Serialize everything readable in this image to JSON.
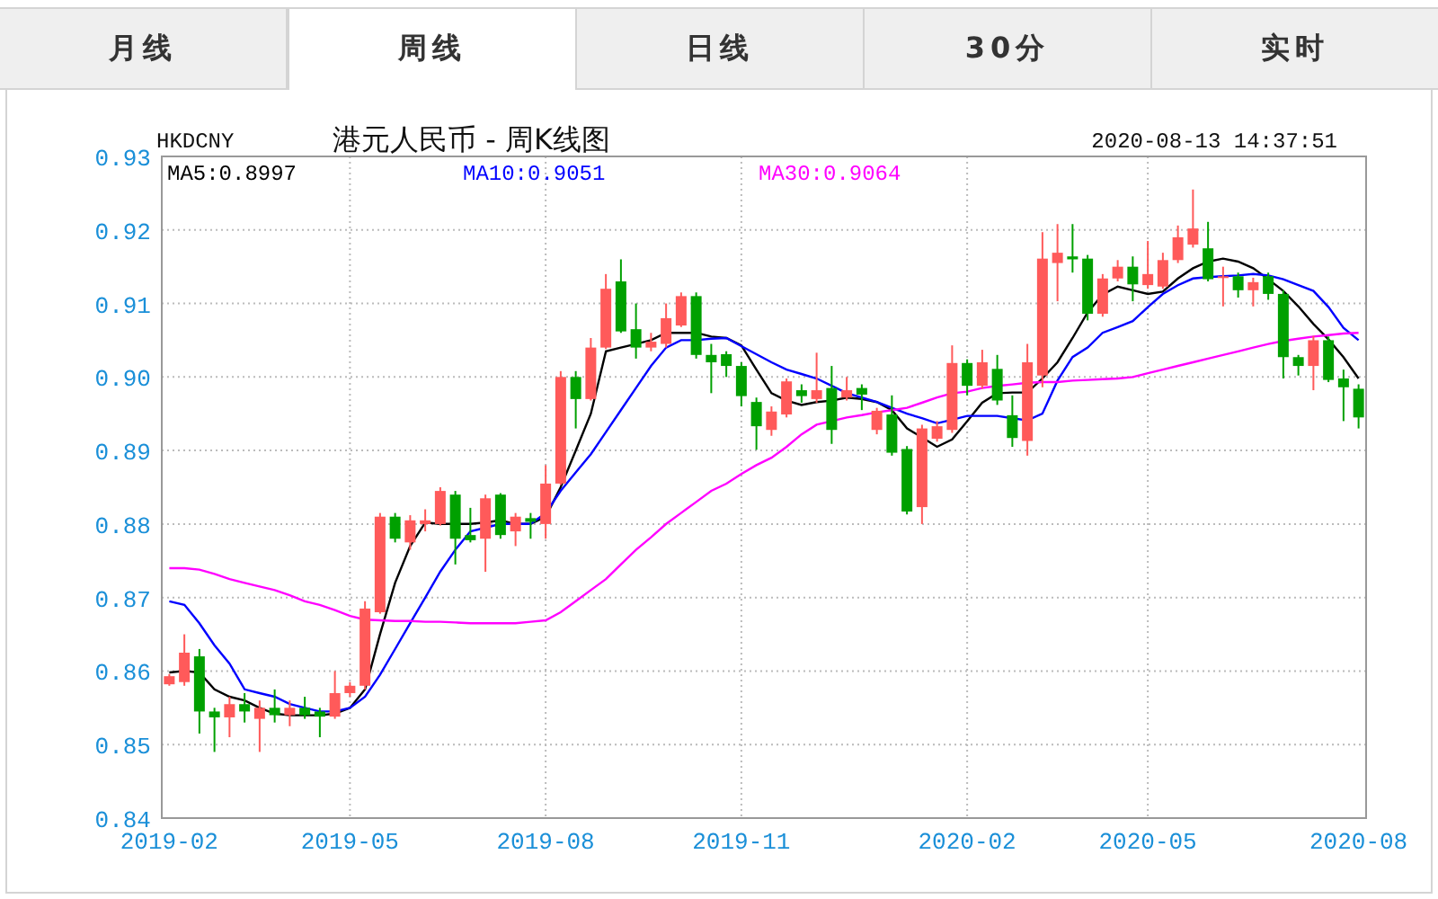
{
  "tabs": [
    {
      "label": "月线",
      "selected": false
    },
    {
      "label": "周线",
      "selected": true
    },
    {
      "label": "日线",
      "selected": false
    },
    {
      "label": "30分",
      "selected": false
    },
    {
      "label": "实时",
      "selected": false
    }
  ],
  "chart": {
    "symbol": "HKDCNY",
    "title": "港元人民币 - 周K线图",
    "timestamp": "2020-08-13 14:37:51",
    "chart_data": {
      "type": "candlestick",
      "grid": true,
      "categories": [
        "2019-02",
        null,
        null,
        null,
        null,
        null,
        null,
        null,
        null,
        null,
        null,
        null,
        "2019-05",
        null,
        null,
        null,
        null,
        null,
        null,
        null,
        null,
        null,
        null,
        null,
        null,
        "2019-08",
        null,
        null,
        null,
        null,
        null,
        null,
        null,
        null,
        null,
        null,
        null,
        null,
        "2019-11",
        null,
        null,
        null,
        null,
        null,
        null,
        null,
        null,
        null,
        null,
        null,
        null,
        null,
        null,
        "2020-02",
        null,
        null,
        null,
        null,
        null,
        null,
        null,
        null,
        null,
        null,
        null,
        "2020-05",
        null,
        null,
        null,
        null,
        null,
        null,
        null,
        null,
        null,
        null,
        null,
        null,
        null,
        "2020-08"
      ],
      "ylim": [
        0.84,
        0.93
      ],
      "yticks": [
        {
          "value": 0.84,
          "label": "0.84"
        },
        {
          "value": 0.85,
          "label": "0.85"
        },
        {
          "value": 0.86,
          "label": "0.86"
        },
        {
          "value": 0.87,
          "label": "0.87"
        },
        {
          "value": 0.88,
          "label": "0.88"
        },
        {
          "value": 0.89,
          "label": "0.89"
        },
        {
          "value": 0.9,
          "label": "0.90"
        },
        {
          "value": 0.91,
          "label": "0.91"
        },
        {
          "value": 0.92,
          "label": "0.92"
        },
        {
          "value": 0.93,
          "label": "0.93"
        }
      ],
      "series": [
        {
          "name": "MA5:0.8997",
          "type": "line",
          "color": "#000000",
          "values": [
            0.8598,
            0.86,
            0.8598,
            0.8575,
            0.8565,
            0.856,
            0.855,
            0.8542,
            0.854,
            0.854,
            0.854,
            0.8542,
            0.855,
            0.8575,
            0.865,
            0.872,
            0.877,
            0.8802,
            0.88,
            0.88,
            0.88,
            0.8802,
            0.8805,
            0.88,
            0.88,
            0.881,
            0.885,
            0.89,
            0.895,
            0.9035,
            0.904,
            0.9045,
            0.905,
            0.906,
            0.906,
            0.906,
            0.9055,
            0.9053,
            0.9043,
            0.901,
            0.8978,
            0.8968,
            0.8962,
            0.8966,
            0.8968,
            0.8972,
            0.897,
            0.8966,
            0.8955,
            0.893,
            0.8918,
            0.8905,
            0.8915,
            0.894,
            0.8965,
            0.8978,
            0.8979,
            0.8979,
            0.8998,
            0.902,
            0.9053,
            0.9088,
            0.9112,
            0.9123,
            0.9118,
            0.9113,
            0.9116,
            0.9134,
            0.9148,
            0.9157,
            0.9161,
            0.9157,
            0.9148,
            0.9133,
            0.9117,
            0.9096,
            0.9072,
            0.9051,
            0.9027,
            0.8998
          ]
        },
        {
          "name": "MA10:0.9051",
          "type": "line",
          "color": "#0000ff",
          "values": [
            0.8695,
            0.869,
            0.8665,
            0.8635,
            0.861,
            0.8575,
            0.857,
            0.8565,
            0.8555,
            0.855,
            0.8545,
            0.8545,
            0.855,
            0.8565,
            0.8595,
            0.863,
            0.8665,
            0.87,
            0.8735,
            0.8765,
            0.879,
            0.8795,
            0.88,
            0.88,
            0.88,
            0.8815,
            0.8845,
            0.887,
            0.8895,
            0.8925,
            0.8955,
            0.8985,
            0.9015,
            0.904,
            0.905,
            0.905,
            0.9052,
            0.9053,
            0.9042,
            0.9031,
            0.902,
            0.901,
            0.9004,
            0.8998,
            0.8988,
            0.8978,
            0.8972,
            0.8966,
            0.8958,
            0.895,
            0.8944,
            0.8937,
            0.8942,
            0.8947,
            0.8947,
            0.8947,
            0.8944,
            0.8941,
            0.895,
            0.8995,
            0.9027,
            0.904,
            0.906,
            0.9068,
            0.9076,
            0.9095,
            0.9113,
            0.9125,
            0.9134,
            0.9136,
            0.9137,
            0.9138,
            0.914,
            0.9138,
            0.9133,
            0.9125,
            0.9117,
            0.9095,
            0.9067,
            0.905
          ]
        },
        {
          "name": "MA30:0.9064",
          "type": "line",
          "color": "#ff00ff",
          "values": [
            0.874,
            0.874,
            0.8738,
            0.8732,
            0.8725,
            0.872,
            0.8715,
            0.871,
            0.8703,
            0.8695,
            0.869,
            0.8683,
            0.8675,
            0.867,
            0.8669,
            0.8668,
            0.8668,
            0.8667,
            0.8667,
            0.8666,
            0.8665,
            0.8665,
            0.8665,
            0.8665,
            0.8667,
            0.8669,
            0.868,
            0.8695,
            0.871,
            0.8725,
            0.8745,
            0.8765,
            0.8782,
            0.88,
            0.8815,
            0.883,
            0.8845,
            0.8855,
            0.8868,
            0.888,
            0.889,
            0.8905,
            0.8922,
            0.8935,
            0.894,
            0.8945,
            0.8948,
            0.8952,
            0.8955,
            0.8958,
            0.8965,
            0.8972,
            0.8978,
            0.898,
            0.8985,
            0.8988,
            0.899,
            0.8992,
            0.8993,
            0.8993,
            0.8995,
            0.8996,
            0.8997,
            0.8998,
            0.9,
            0.9005,
            0.901,
            0.9015,
            0.902,
            0.9025,
            0.903,
            0.9035,
            0.904,
            0.9045,
            0.9049,
            0.9052,
            0.9055,
            0.9057,
            0.9059,
            0.906
          ]
        }
      ],
      "ohlc": [
        [
          0.8582,
          0.8596,
          0.858,
          0.8593
        ],
        [
          0.8585,
          0.865,
          0.858,
          0.8625
        ],
        [
          0.862,
          0.863,
          0.8515,
          0.8545
        ],
        [
          0.8545,
          0.855,
          0.849,
          0.8537
        ],
        [
          0.8537,
          0.8565,
          0.851,
          0.8555
        ],
        [
          0.8555,
          0.857,
          0.853,
          0.8545
        ],
        [
          0.8535,
          0.856,
          0.849,
          0.855
        ],
        [
          0.855,
          0.8575,
          0.853,
          0.854
        ],
        [
          0.854,
          0.856,
          0.8525,
          0.855
        ],
        [
          0.855,
          0.8565,
          0.8535,
          0.854
        ],
        [
          0.8545,
          0.855,
          0.851,
          0.8538
        ],
        [
          0.8538,
          0.86,
          0.8535,
          0.857
        ],
        [
          0.857,
          0.8585,
          0.8565,
          0.858
        ],
        [
          0.858,
          0.8695,
          0.8575,
          0.8685
        ],
        [
          0.868,
          0.8815,
          0.8678,
          0.881
        ],
        [
          0.881,
          0.8815,
          0.8775,
          0.878
        ],
        [
          0.8775,
          0.8812,
          0.8765,
          0.8805
        ],
        [
          0.88,
          0.882,
          0.879,
          0.8805
        ],
        [
          0.88,
          0.885,
          0.8798,
          0.8845
        ],
        [
          0.884,
          0.8845,
          0.8745,
          0.878
        ],
        [
          0.8785,
          0.8822,
          0.8775,
          0.8778
        ],
        [
          0.878,
          0.884,
          0.8735,
          0.8835
        ],
        [
          0.884,
          0.8842,
          0.878,
          0.8785
        ],
        [
          0.879,
          0.8815,
          0.877,
          0.881
        ],
        [
          0.8808,
          0.8815,
          0.878,
          0.8803
        ],
        [
          0.88,
          0.888,
          0.878,
          0.8855
        ],
        [
          0.8855,
          0.9008,
          0.8853,
          0.9
        ],
        [
          0.9,
          0.9008,
          0.893,
          0.897
        ],
        [
          0.897,
          0.9053,
          0.8968,
          0.904
        ],
        [
          0.904,
          0.914,
          0.9038,
          0.912
        ],
        [
          0.913,
          0.916,
          0.906,
          0.9062
        ],
        [
          0.9065,
          0.91,
          0.9025,
          0.904
        ],
        [
          0.904,
          0.906,
          0.9035,
          0.9048
        ],
        [
          0.9045,
          0.91,
          0.904,
          0.908
        ],
        [
          0.907,
          0.9115,
          0.9068,
          0.911
        ],
        [
          0.911,
          0.9115,
          0.9025,
          0.903
        ],
        [
          0.903,
          0.9045,
          0.8978,
          0.902
        ],
        [
          0.9031,
          0.9035,
          0.9,
          0.9015
        ],
        [
          0.9015,
          0.902,
          0.896,
          0.8974
        ],
        [
          0.8966,
          0.8972,
          0.8901,
          0.8933
        ],
        [
          0.8928,
          0.896,
          0.892,
          0.8953
        ],
        [
          0.8949,
          0.8998,
          0.8945,
          0.8994
        ],
        [
          0.8982,
          0.899,
          0.8965,
          0.8974
        ],
        [
          0.897,
          0.9033,
          0.8965,
          0.8982
        ],
        [
          0.8985,
          0.9015,
          0.8909,
          0.8928
        ],
        [
          0.8972,
          0.9,
          0.8968,
          0.8982
        ],
        [
          0.8985,
          0.899,
          0.8955,
          0.8976
        ],
        [
          0.8928,
          0.8958,
          0.8922,
          0.8954
        ],
        [
          0.8949,
          0.8975,
          0.8893,
          0.8897
        ],
        [
          0.8902,
          0.8906,
          0.8813,
          0.8817
        ],
        [
          0.8823,
          0.8935,
          0.88,
          0.893
        ],
        [
          0.8916,
          0.894,
          0.8912,
          0.8933
        ],
        [
          0.8928,
          0.9043,
          0.8924,
          0.9019
        ],
        [
          0.9019,
          0.9024,
          0.8975,
          0.8988
        ],
        [
          0.8988,
          0.9037,
          0.8984,
          0.902
        ],
        [
          0.9011,
          0.903,
          0.8962,
          0.8968
        ],
        [
          0.8948,
          0.8975,
          0.8905,
          0.8917
        ],
        [
          0.8913,
          0.9045,
          0.8893,
          0.902
        ],
        [
          0.9002,
          0.9197,
          0.8986,
          0.9161
        ],
        [
          0.9155,
          0.9208,
          0.9103,
          0.9169
        ],
        [
          0.9164,
          0.9208,
          0.9142,
          0.916
        ],
        [
          0.9161,
          0.9166,
          0.9077,
          0.9086
        ],
        [
          0.9086,
          0.914,
          0.9082,
          0.9134
        ],
        [
          0.9134,
          0.9159,
          0.913,
          0.915
        ],
        [
          0.915,
          0.9164,
          0.9103,
          0.9126
        ],
        [
          0.9125,
          0.9185,
          0.912,
          0.914
        ],
        [
          0.9123,
          0.9169,
          0.912,
          0.9159
        ],
        [
          0.9159,
          0.9206,
          0.9155,
          0.919
        ],
        [
          0.918,
          0.9255,
          0.9176,
          0.9202
        ],
        [
          0.9175,
          0.9211,
          0.913,
          0.9133
        ],
        [
          0.9135,
          0.915,
          0.9096,
          0.9137
        ],
        [
          0.9137,
          0.9142,
          0.9108,
          0.9118
        ],
        [
          0.9118,
          0.9135,
          0.9096,
          0.9129
        ],
        [
          0.9137,
          0.9142,
          0.9105,
          0.9113
        ],
        [
          0.9113,
          0.9118,
          0.8998,
          0.9027
        ],
        [
          0.9027,
          0.903,
          0.9002,
          0.9015
        ],
        [
          0.9015,
          0.9056,
          0.8982,
          0.905
        ],
        [
          0.905,
          0.9055,
          0.8993,
          0.8996
        ],
        [
          0.8998,
          0.901,
          0.894,
          0.8986
        ],
        [
          0.8984,
          0.899,
          0.893,
          0.8945
        ]
      ]
    }
  }
}
